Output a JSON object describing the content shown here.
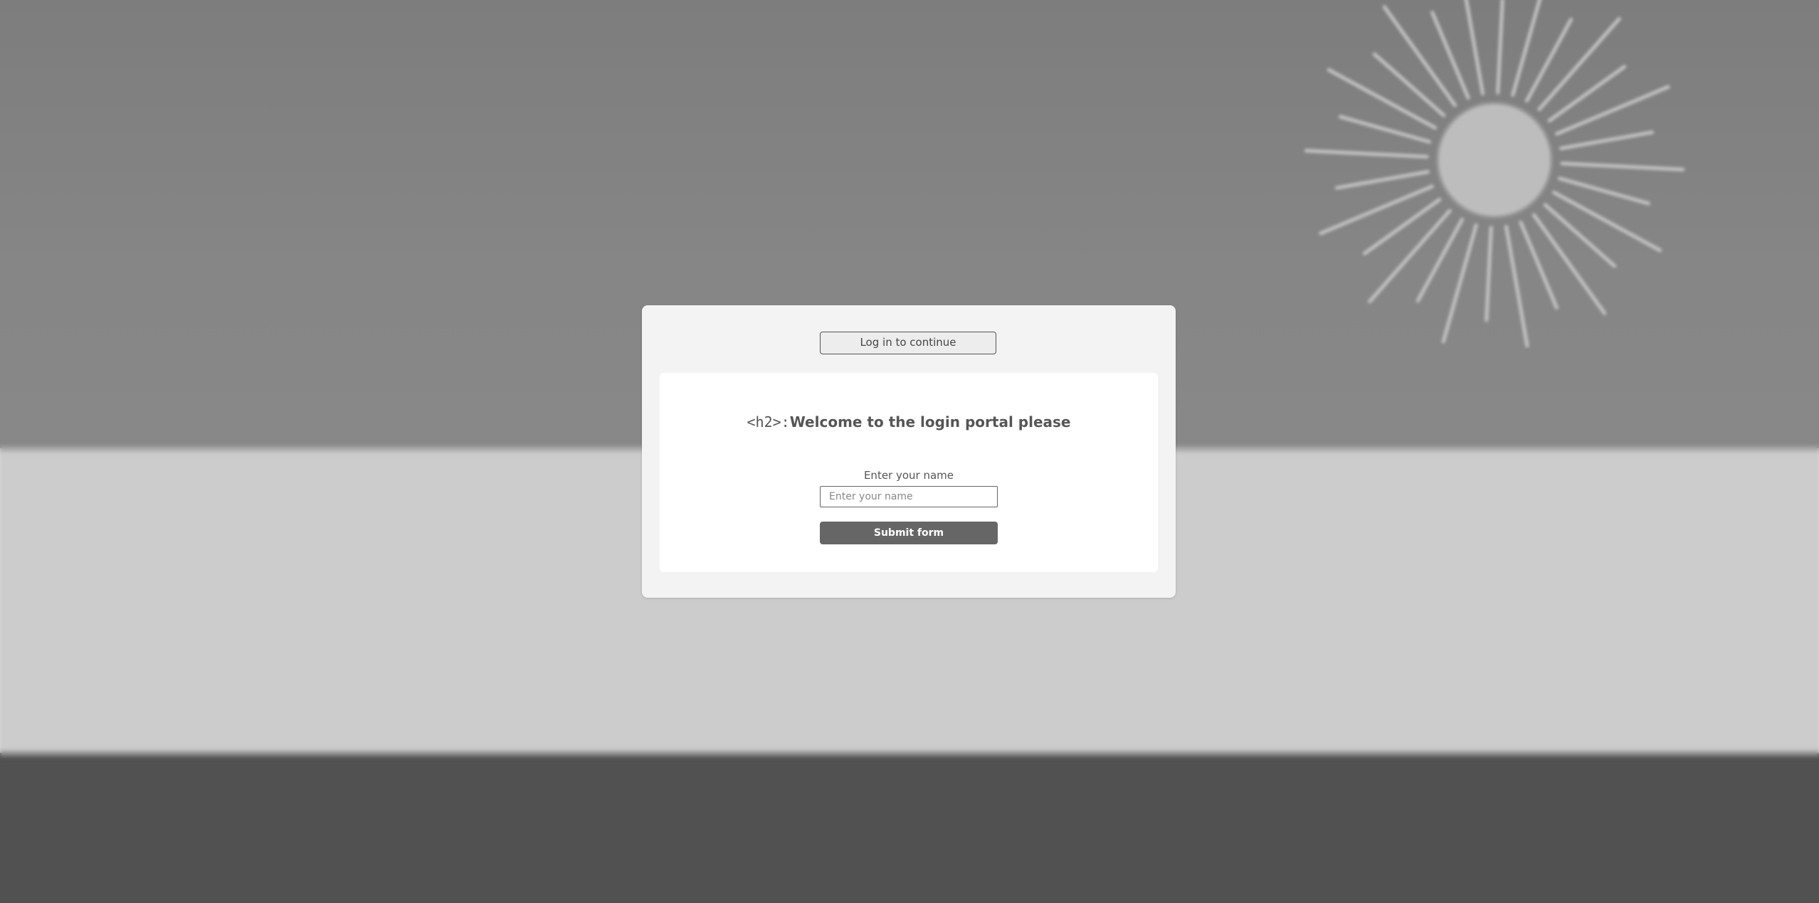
{
  "app": {
    "badge_text": "Log in to continue"
  },
  "form": {
    "heading_prefix": "<h2>:",
    "heading_text": "Welcome to the login portal please",
    "label": "Enter your name",
    "input_value": "",
    "input_placeholder": "Enter your name",
    "submit_label": "Submit form"
  },
  "colors": {
    "sky": "#868686",
    "ground": "#cccccc",
    "floor": "#515151",
    "card": "#f3f3f3",
    "button": "#666666"
  },
  "icons": {
    "sun": "sun-icon"
  }
}
